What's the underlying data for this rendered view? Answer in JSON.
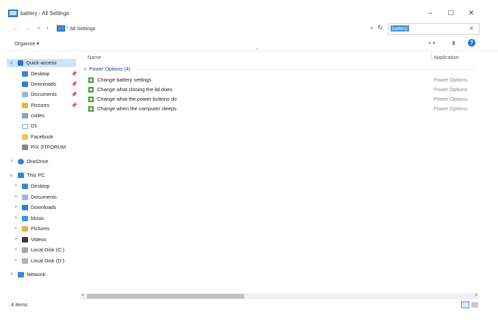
{
  "window": {
    "title": "battery - All Settings",
    "minimize": "–",
    "maximize": "☐",
    "close": "✕"
  },
  "nav": {
    "back": "←",
    "forward": "→",
    "recent": "∨",
    "up": "↑",
    "separator": ">",
    "path": "All Settings",
    "dropdown": "∨",
    "refresh": "↻"
  },
  "search": {
    "value": "battery",
    "clear": "✕"
  },
  "commandbar": {
    "organise": "Organise ▾",
    "view_options": "≡ ▾",
    "pane": "▮",
    "help": "?"
  },
  "sidebar": {
    "quick_access": "Quick access",
    "quick_items": [
      {
        "label": "Desktop",
        "pinned": true
      },
      {
        "label": "Downloads",
        "pinned": true
      },
      {
        "label": "Documents",
        "pinned": true
      },
      {
        "label": "Pictures",
        "pinned": true
      },
      {
        "label": "codes",
        "pinned": false
      },
      {
        "label": "D1",
        "pinned": false
      },
      {
        "label": "Facebook",
        "pinned": false
      },
      {
        "label": "PIX STFORUM",
        "pinned": false
      }
    ],
    "pin_glyph": "📌",
    "onedrive": "OneDrive",
    "this_pc": "This PC",
    "pc_items": [
      "Desktop",
      "Documents",
      "Downloads",
      "Music",
      "Pictures",
      "Videos",
      "Local Disk (C:)",
      "Local Disk (D:)"
    ],
    "network": "Network",
    "chev_right": ">",
    "chev_down": "∨"
  },
  "content": {
    "col_name": "Name",
    "col_location": "Application",
    "sort_indicator": "^",
    "group_label": "Power Options (4)",
    "group_chev": "∨",
    "rows": [
      {
        "name": "Change battery settings",
        "location": "Power Options"
      },
      {
        "name": "Change what closing the lid does",
        "location": "Power Options"
      },
      {
        "name": "Change what the power buttons do",
        "location": "Power Options"
      },
      {
        "name": "Change when the computer sleeps",
        "location": "Power Options"
      }
    ]
  },
  "status": {
    "items": "4 items"
  },
  "colors": {
    "selection": "#cce4f7",
    "search_highlight": "#4a8fe0",
    "group_text": "#1e3d8f",
    "help_blue": "#1a73d9"
  }
}
